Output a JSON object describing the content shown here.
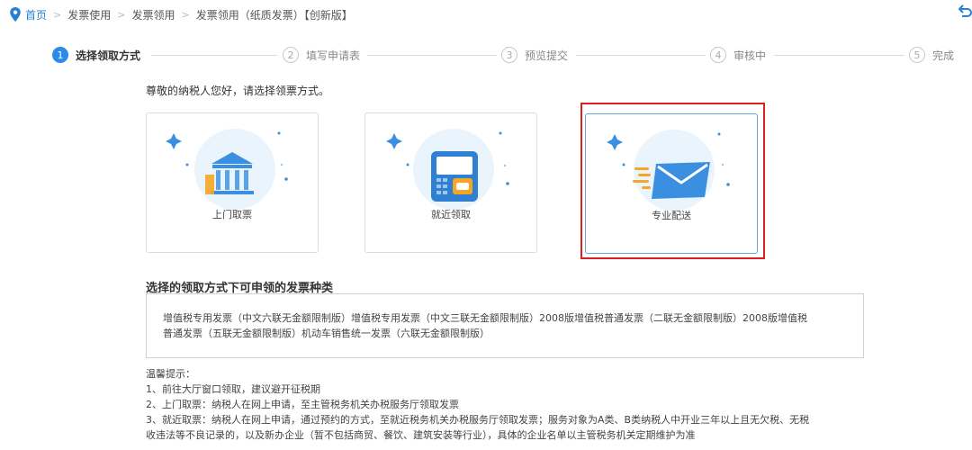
{
  "breadcrumb": {
    "items": [
      "首页",
      "发票使用",
      "发票领用",
      "发票领用（纸质发票）【创新版】"
    ]
  },
  "steps": [
    {
      "num": "1",
      "label": "选择领取方式"
    },
    {
      "num": "2",
      "label": "填写申请表"
    },
    {
      "num": "3",
      "label": "预览提交"
    },
    {
      "num": "4",
      "label": "审核中"
    },
    {
      "num": "5",
      "label": "完成"
    }
  ],
  "intro": "尊敬的纳税人您好，请选择领票方式。",
  "cards": [
    {
      "label": "上门取票",
      "icon": "bank-icon"
    },
    {
      "label": "就近领取",
      "icon": "atm-icon"
    },
    {
      "label": "专业配送",
      "icon": "envelope-icon"
    }
  ],
  "section": {
    "title": "选择的领取方式下可申领的发票种类",
    "invoice_lines": [
      "增值税专用发票（中文六联无金额限制版）增值税专用发票（中文三联无金额限制版）2008版增值税普通发票（二联无金额限制版）2008版增值税",
      "普通发票（五联无金额限制版）机动车销售统一发票（六联无金额限制版）"
    ]
  },
  "tips": {
    "title": "温馨提示：",
    "lines": [
      "1、前往大厅窗口领取，建议避开征税期",
      "2、上门取票：纳税人在网上申请，至主管税务机关办税服务厅领取发票",
      "3、就近取票：纳税人在网上申请，通过预约的方式，至就近税务机关办税服务厅领取发票；服务对象为A类、B类纳税人中开业三年以上且无欠税、无税",
      "收违法等不良记录的，以及新办企业（暂不包括商贸、餐饮、建筑安装等行业），具体的企业名单以主管税务机关定期维护为准"
    ]
  },
  "colors": {
    "accent": "#2c8be8",
    "highlight": "#d9201e"
  }
}
